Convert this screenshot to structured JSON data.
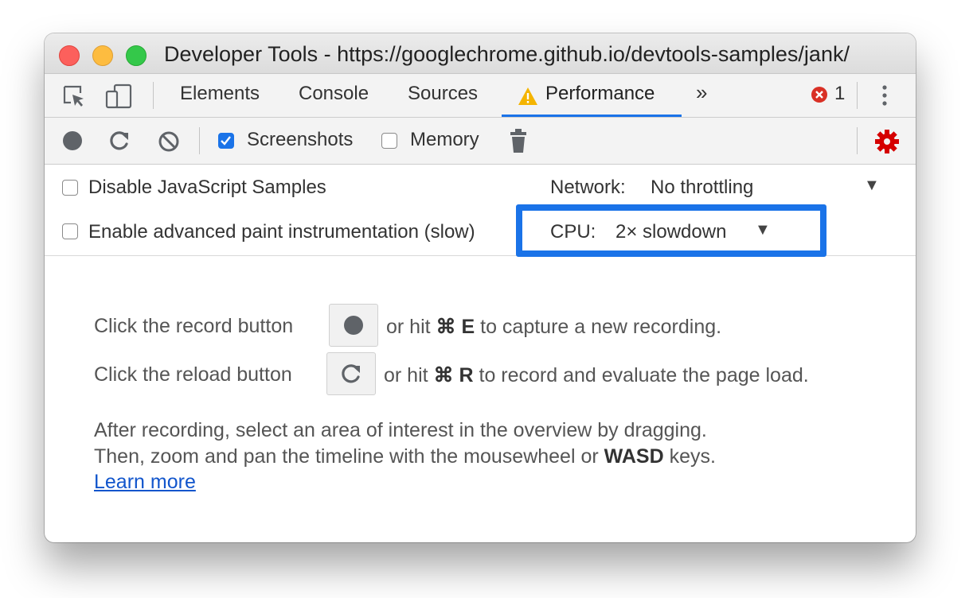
{
  "window": {
    "title": "Developer Tools - https://googlechrome.github.io/devtools-samples/jank/"
  },
  "tabs": {
    "elements": "Elements",
    "console": "Console",
    "sources": "Sources",
    "performance": "Performance",
    "more": "»",
    "error_count": "1"
  },
  "toolbar": {
    "screenshots_label": "Screenshots",
    "screenshots_checked": true,
    "memory_label": "Memory",
    "memory_checked": false
  },
  "settings": {
    "disable_js_samples": "Disable JavaScript Samples",
    "advanced_paint": "Enable advanced paint instrumentation (slow)",
    "network_label": "Network:",
    "network_value": "No throttling",
    "cpu_label": "CPU:",
    "cpu_value": "2× slowdown",
    "dropdown_arrow": "▼"
  },
  "landing": {
    "record_pre": "Click the record button",
    "record_mid": "or hit",
    "record_key": "⌘ E",
    "record_post": "to capture a new recording.",
    "reload_pre": "Click the reload button",
    "reload_mid": "or hit",
    "reload_key": "⌘ R",
    "reload_post": "to record and evaluate the page load.",
    "after_line1": "After recording, select an area of interest in the overview by dragging.",
    "after_line2_pre": "Then, zoom and pan the timeline with the mousewheel or",
    "after_line2_key": "WASD",
    "after_line2_post": "keys.",
    "learn_more": "Learn more"
  },
  "colors": {
    "accent": "#1a73e8",
    "warning": "#f4b400",
    "error": "#d93025",
    "settings_gear": "#d50000"
  }
}
